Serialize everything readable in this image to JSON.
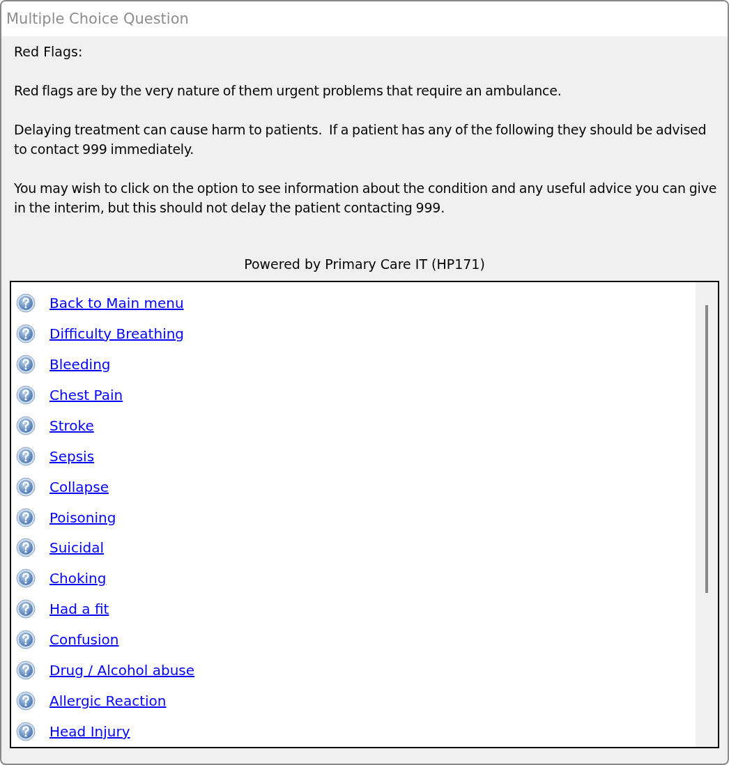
{
  "window": {
    "title": "Multiple Choice Question"
  },
  "heading": "Red Flags:",
  "paragraphs": [
    "Red flags are by the very nature of them urgent problems that require an ambulance.",
    "Delaying treatment can cause harm to patients.  If a patient has any of the following they should be advised to contact 999 immediately.",
    "You may wish to click on the option to see information about the condition and any useful advice you can give in the interim, but this should not delay the patient contacting 999."
  ],
  "powered_by": "Powered by Primary Care IT (HP171)",
  "options": [
    {
      "label": "Back to Main menu"
    },
    {
      "label": "Difficulty Breathing"
    },
    {
      "label": "Bleeding"
    },
    {
      "label": "Chest Pain"
    },
    {
      "label": "Stroke"
    },
    {
      "label": "Sepsis"
    },
    {
      "label": "Collapse"
    },
    {
      "label": "Poisoning"
    },
    {
      "label": "Suicidal"
    },
    {
      "label": "Choking"
    },
    {
      "label": "Had a fit"
    },
    {
      "label": "Confusion"
    },
    {
      "label": "Drug / Alcohol abuse"
    },
    {
      "label": "Allergic Reaction"
    },
    {
      "label": "Head Injury"
    }
  ]
}
